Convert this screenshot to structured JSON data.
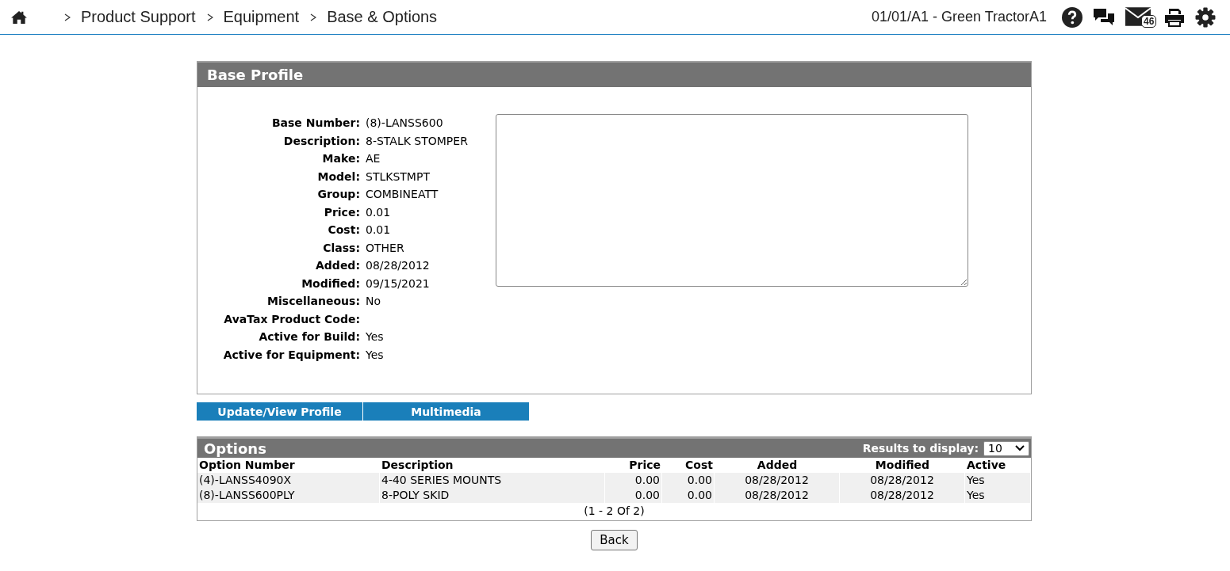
{
  "breadcrumb": [
    {
      "label": "Product Support"
    },
    {
      "label": "Equipment"
    },
    {
      "label": "Base & Options"
    }
  ],
  "location": "01/01/A1 - Green TractorA1",
  "mail_badge": "46",
  "base_profile": {
    "title": "Base Profile",
    "fields": [
      {
        "label": "Base Number:",
        "value": "(8)-LANSS600"
      },
      {
        "label": "Description:",
        "value": "8-STALK STOMPER"
      },
      {
        "label": "Make:",
        "value": "AE"
      },
      {
        "label": "Model:",
        "value": "STLKSTMPT"
      },
      {
        "label": "Group:",
        "value": "COMBINEATT"
      },
      {
        "label": "Price:",
        "value": "0.01"
      },
      {
        "label": "Cost:",
        "value": "0.01"
      },
      {
        "label": "Class:",
        "value": "OTHER"
      },
      {
        "label": "Added:",
        "value": "08/28/2012"
      },
      {
        "label": "Modified:",
        "value": "09/15/2021"
      },
      {
        "label": "Miscellaneous:",
        "value": "No"
      },
      {
        "label": "AvaTax Product Code:"
      },
      {
        "label": "Active for Build:",
        "value": "Yes"
      },
      {
        "label": "Active for Equipment:",
        "value": "Yes"
      }
    ]
  },
  "actions": [
    "Update/View Profile",
    "Multimedia"
  ],
  "options": {
    "title": "Options",
    "results_label": "Results to display:",
    "results_value": "10",
    "columns": [
      "Option Number",
      "Description",
      "Price",
      "Cost",
      "Added",
      "Modified",
      "Active"
    ],
    "rows": [
      [
        "(4)-LANSS4090X",
        "4-40 SERIES MOUNTS",
        "0.00",
        "0.00",
        "08/28/2012",
        "08/28/2012",
        "Yes"
      ],
      [
        "(8)-LANSS600PLY",
        "8-POLY SKID",
        "0.00",
        "0.00",
        "08/28/2012",
        "08/28/2012",
        "Yes"
      ]
    ],
    "pager": "(1 - 2 Of 2)"
  },
  "back_button": "Back"
}
